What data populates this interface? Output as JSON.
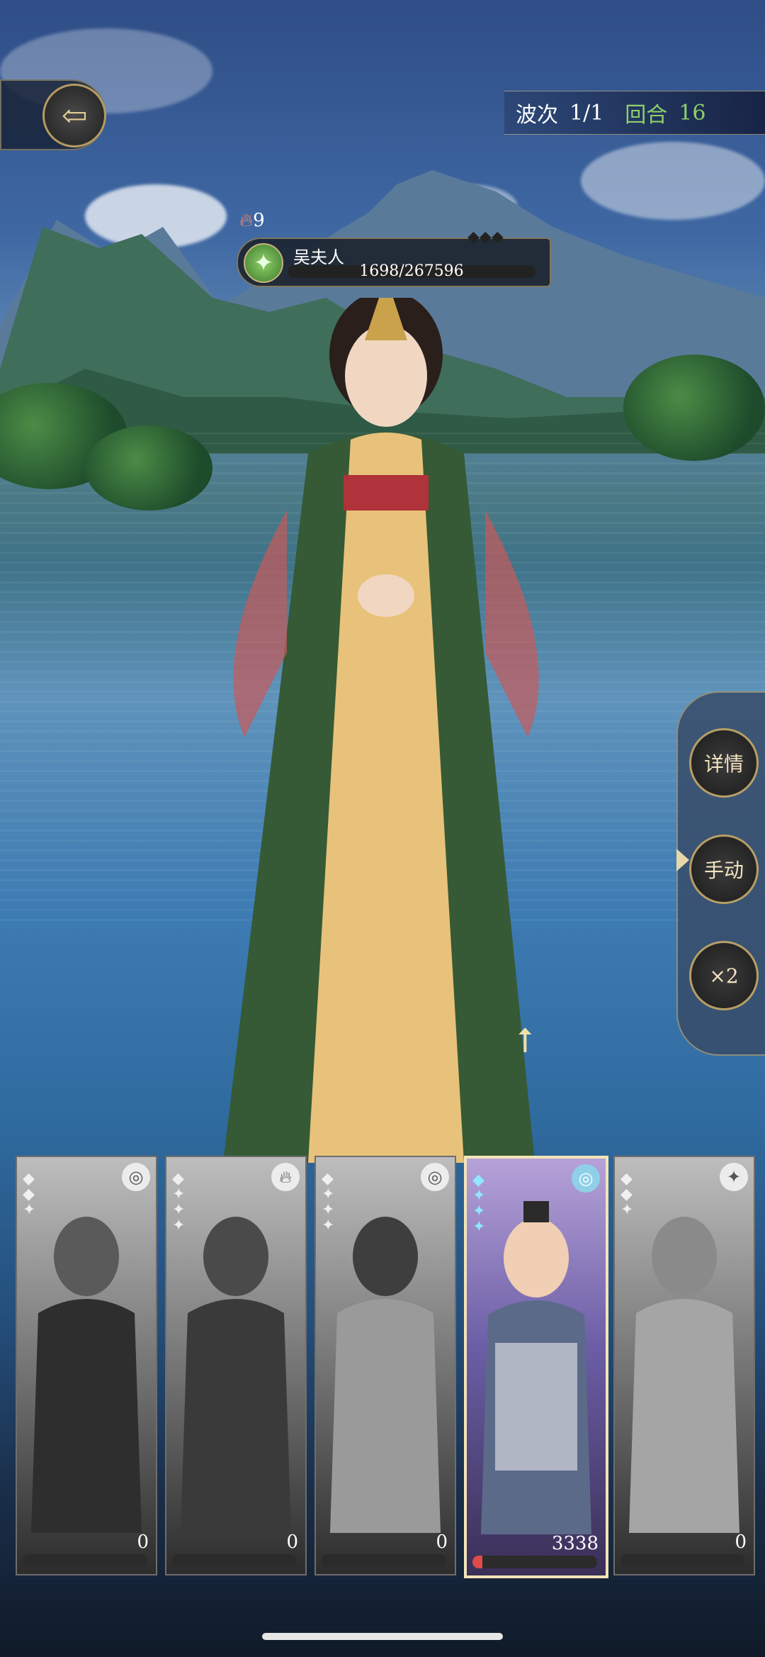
{
  "header": {
    "wave_label": "波次",
    "wave_value": "1/1",
    "round_label": "回合",
    "round_value": "16"
  },
  "enemy": {
    "fire_count": "9",
    "name": "吴夫人",
    "hp_text": "1698/267596",
    "hp_fraction": 0.0063
  },
  "side_menu": {
    "details_label": "详情",
    "manual_label": "手动",
    "speed_label": "×2"
  },
  "cards": [
    {
      "element_icon": "swirl-icon",
      "stars": 3,
      "value": "0"
    },
    {
      "element_icon": "fire-icon",
      "stars": 4,
      "value": "0"
    },
    {
      "element_icon": "swirl-icon",
      "stars": 4,
      "value": "0"
    },
    {
      "element_icon": "swirl-icon",
      "stars": 4,
      "value": "3338"
    },
    {
      "element_icon": "shuriken-icon",
      "stars": 3,
      "value": "0"
    }
  ],
  "colors": {
    "accent_gold": "#b59b62",
    "hp_green": "#8fd06a"
  }
}
